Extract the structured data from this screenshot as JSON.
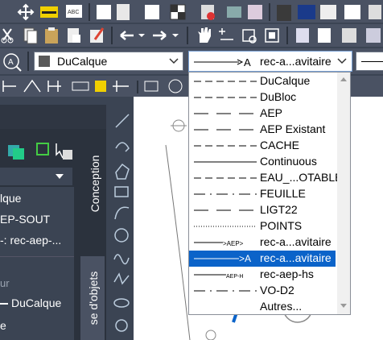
{
  "layer_combo": {
    "value": "DuCalque",
    "swatch_color": "#595959"
  },
  "linetype_combo": {
    "value": "rec-a...avitaire",
    "sample": "———————>A"
  },
  "linetype_options": [
    {
      "label": "DuCalque",
      "pattern": "dash"
    },
    {
      "label": "DuBloc",
      "pattern": "dash"
    },
    {
      "label": "AEP",
      "pattern": "longdash"
    },
    {
      "label": "AEP Existant",
      "pattern": "longdash"
    },
    {
      "label": "CACHE",
      "pattern": "dash"
    },
    {
      "label": "Continuous",
      "pattern": "solid"
    },
    {
      "label": "EAU_...OTABLE",
      "pattern": "dash"
    },
    {
      "label": "FEUILLE",
      "pattern": "dashdot"
    },
    {
      "label": "LIGT22",
      "pattern": "longdash"
    },
    {
      "label": "POINTS",
      "pattern": "dot"
    },
    {
      "label": "rec-a...avitaire",
      "pattern": "aep-text",
      "sample": "AEP"
    },
    {
      "label": "rec-a...avitaire",
      "pattern": "arrow-a",
      "sample": "A",
      "selected": true
    },
    {
      "label": "rec-aep-hs",
      "pattern": "aep-hs",
      "sample": "AEP-H"
    },
    {
      "label": "VO-D2",
      "pattern": "dashdot"
    },
    {
      "label": "Autres...",
      "pattern": "none"
    }
  ],
  "side_panel": {
    "items": [
      "lque",
      "EP-SOUT",
      "-: rec-aep-...",
      "ur",
      "DuCalque",
      "e"
    ],
    "tab_conception": "Conception",
    "tab_objets": "se d'objets"
  },
  "colors": {
    "toolbar_bg": "#4a5263",
    "panel_bg": "#3b4453",
    "selection": "#0b63c9"
  }
}
